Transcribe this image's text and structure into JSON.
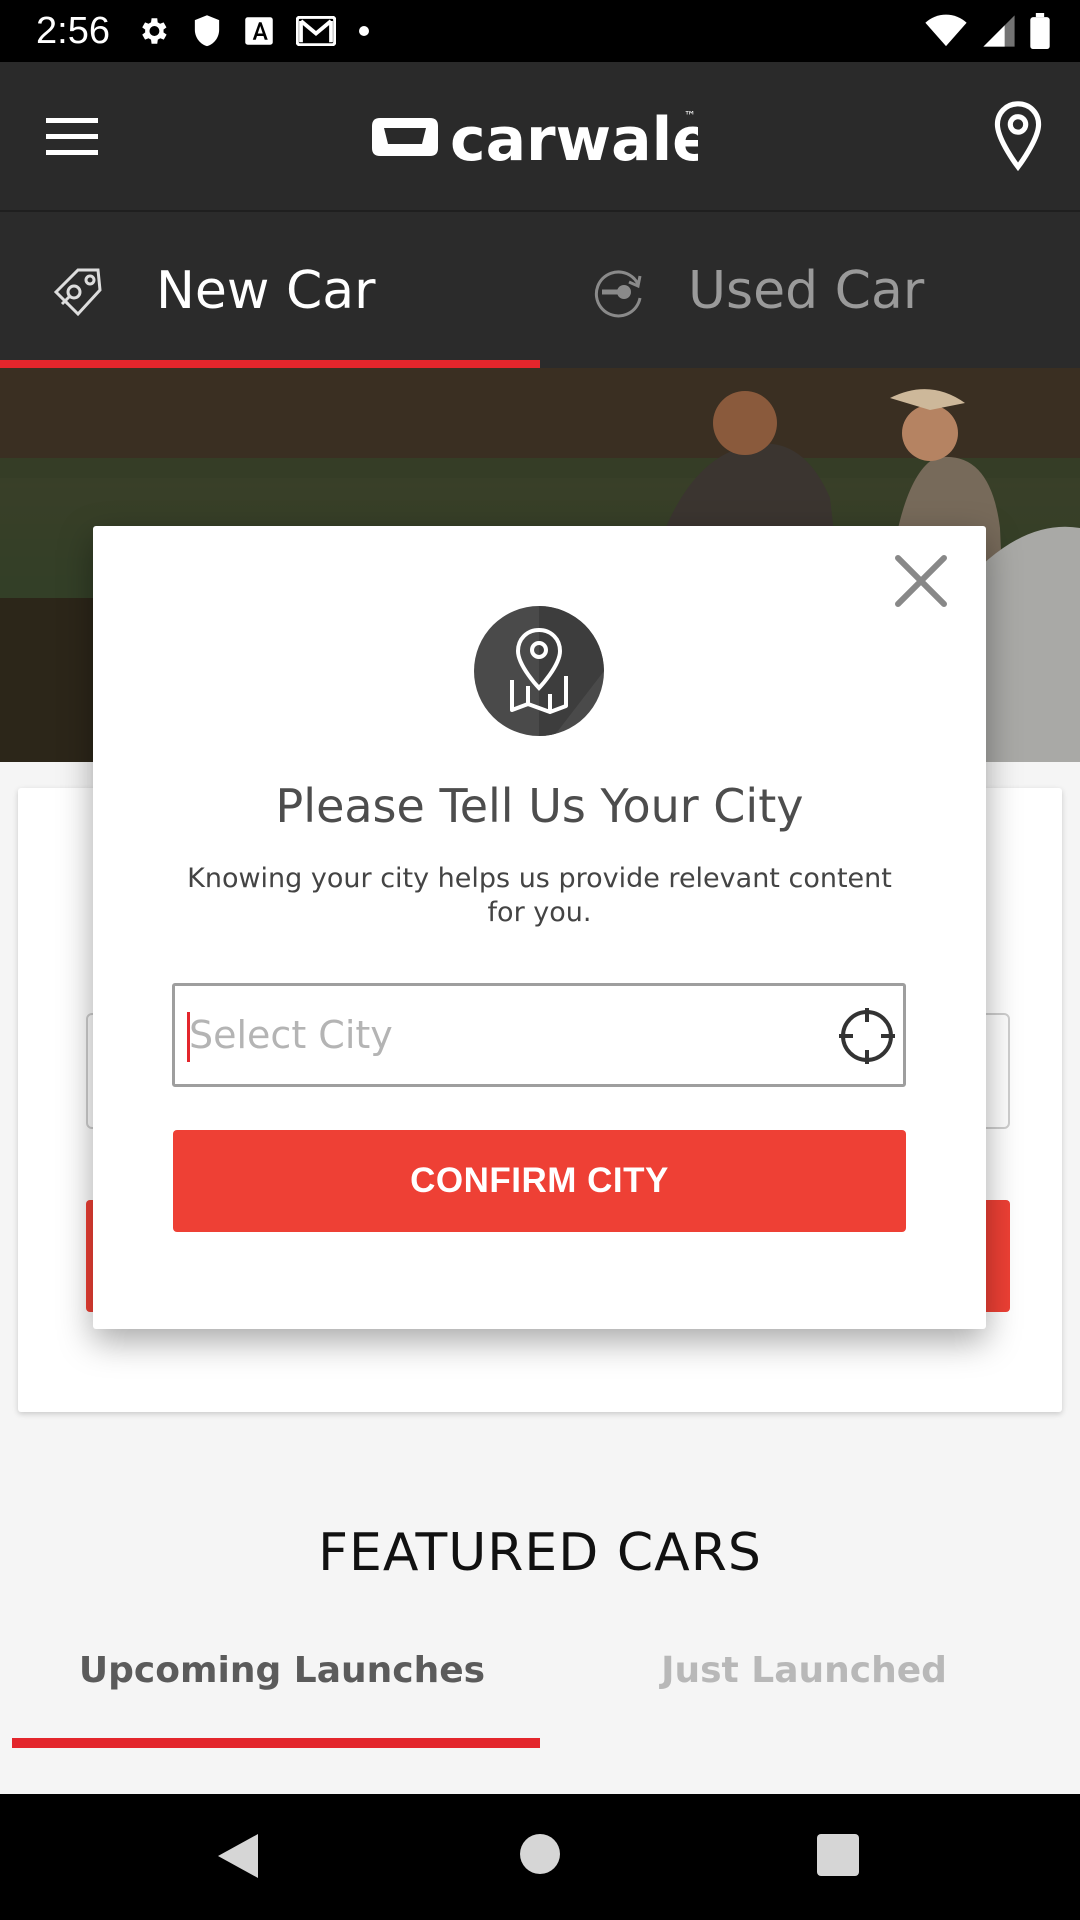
{
  "status_bar": {
    "time": "2:56",
    "icons": [
      "settings-icon",
      "shield-icon",
      "text-a-icon",
      "gmail-icon",
      "dot-icon",
      "wifi-icon",
      "signal-icon",
      "battery-icon"
    ]
  },
  "app_bar": {
    "logo_text": "carwale",
    "trademark": "™",
    "icons": [
      "menu-icon",
      "location-pin-icon"
    ]
  },
  "tabs": {
    "new_car": "New Car",
    "used_car": "Used Car",
    "active": "New Car"
  },
  "dialog": {
    "title": "Please Tell Us Your City",
    "subtitle": "Knowing your city helps us provide relevant content for you.",
    "city_placeholder": "Select City",
    "confirm_label": "CONFIRM CITY"
  },
  "featured": {
    "title": "FEATURED CARS",
    "tabs": [
      "Upcoming Launches",
      "Just Launched"
    ],
    "active": "Upcoming Launches"
  },
  "colors": {
    "accent": "#e3262c",
    "button": "#ee4035",
    "appbar": "#2a2a2a"
  }
}
